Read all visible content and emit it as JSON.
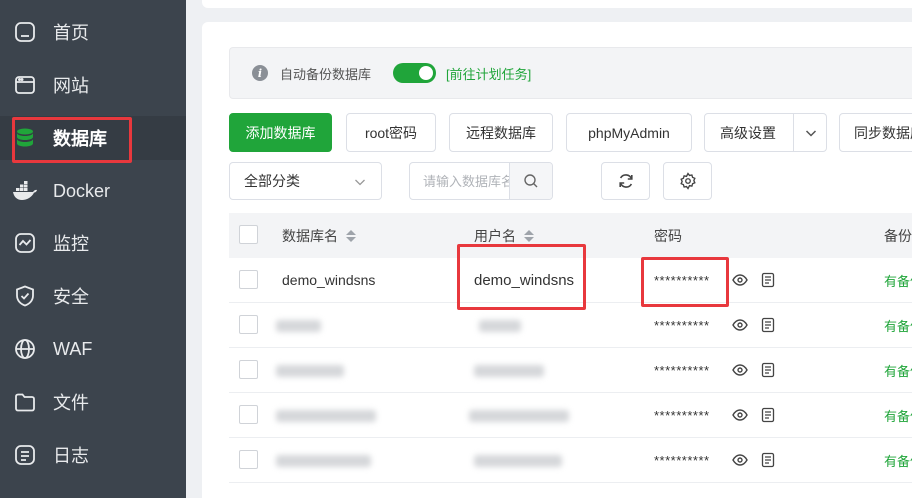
{
  "sidebar": {
    "items": [
      {
        "label": "首页",
        "icon": "home-icon"
      },
      {
        "label": "网站",
        "icon": "website-icon"
      },
      {
        "label": "数据库",
        "icon": "database-icon",
        "active": true
      },
      {
        "label": "Docker",
        "icon": "docker-icon"
      },
      {
        "label": "监控",
        "icon": "monitor-icon"
      },
      {
        "label": "安全",
        "icon": "shield-icon"
      },
      {
        "label": "WAF",
        "icon": "waf-icon"
      },
      {
        "label": "文件",
        "icon": "folder-icon"
      },
      {
        "label": "日志",
        "icon": "log-icon"
      }
    ]
  },
  "notice": {
    "text": "自动备份数据库",
    "link": "[前往计划任务]",
    "toggle_on": true
  },
  "toolbar": {
    "add": "添加数据库",
    "root": "root密码",
    "remote": "远程数据库",
    "phpmyadmin": "phpMyAdmin",
    "advanced": "高级设置",
    "sync": "同步数据库"
  },
  "filter": {
    "category": "全部分类",
    "search_placeholder": "请输入数据库名称"
  },
  "table": {
    "headers": {
      "name": "数据库名",
      "user": "用户名",
      "password": "密码",
      "backup": "备份"
    },
    "rows": [
      {
        "name": "demo_windsns",
        "user": "demo_windsns",
        "password": "**********",
        "backup": "有备份"
      },
      {
        "name": "",
        "user": "",
        "password": "**********",
        "backup": "有备份"
      },
      {
        "name": "",
        "user": "",
        "password": "**********",
        "backup": "有备份"
      },
      {
        "name": "",
        "user": "",
        "password": "**********",
        "backup": "有备份"
      },
      {
        "name": "",
        "user": "",
        "password": "**********",
        "backup": "有备份"
      }
    ]
  },
  "colors": {
    "accent": "#20a53a",
    "sidebar": "#3c444d",
    "highlight": "#e8383d"
  }
}
